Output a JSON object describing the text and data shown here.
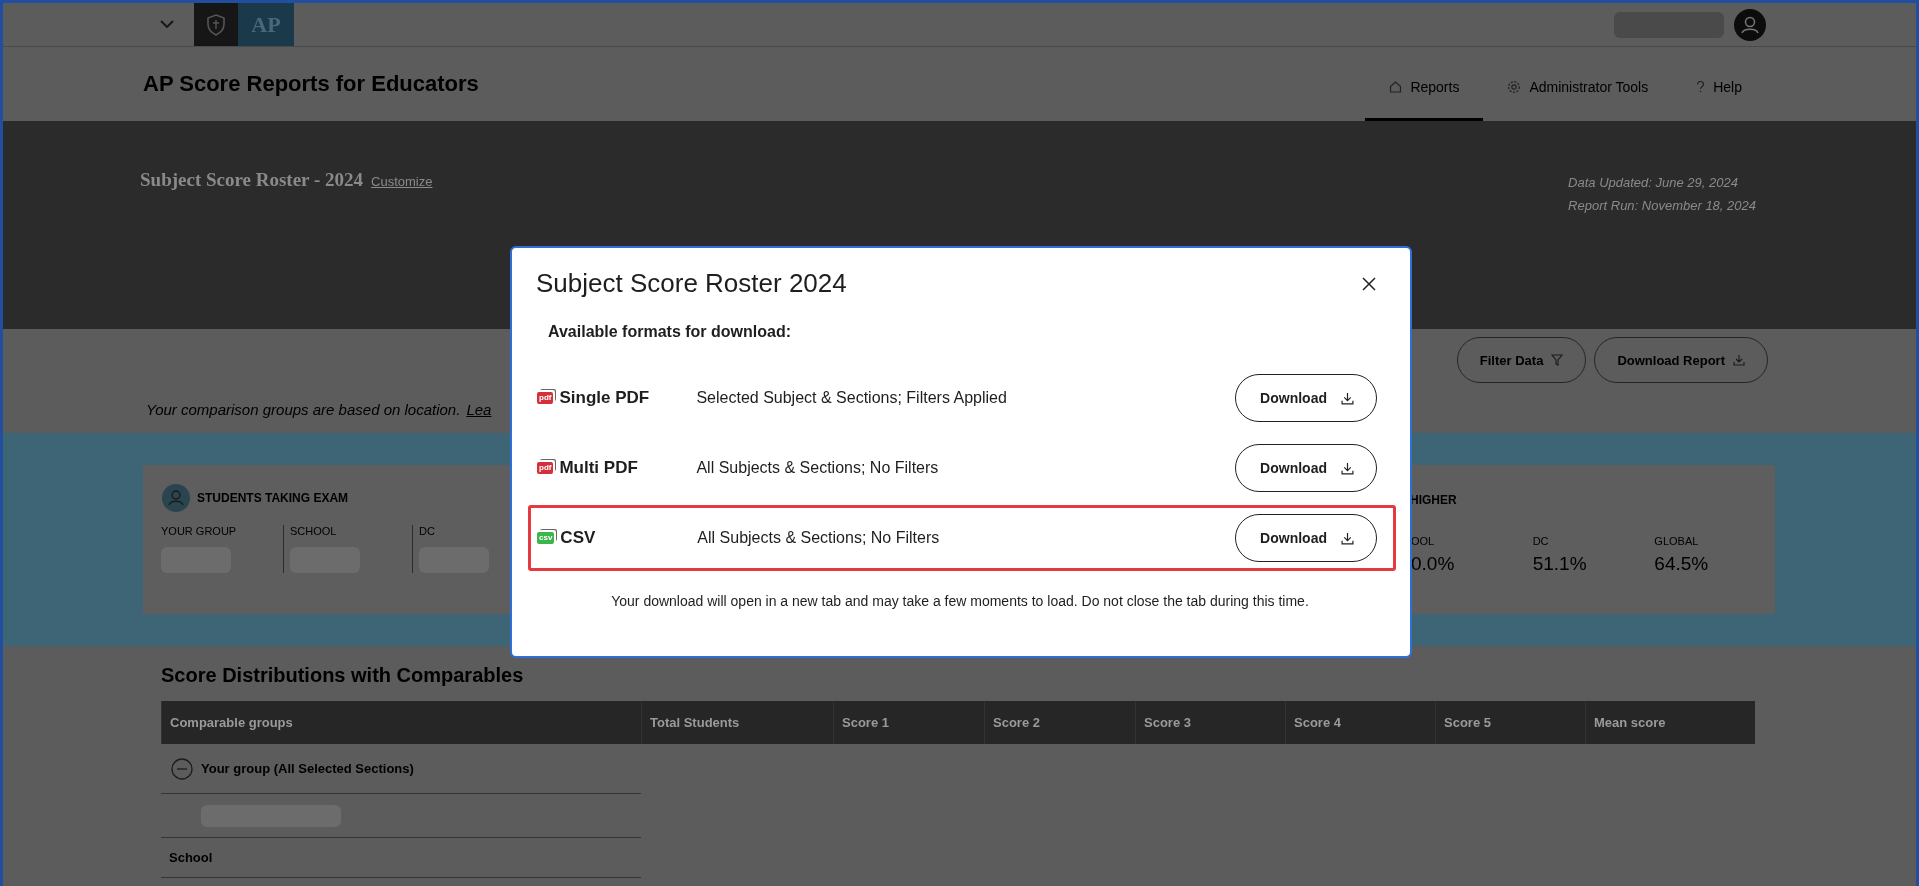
{
  "logo": {
    "text": "AP"
  },
  "page_title": "AP Score Reports for Educators",
  "nav": [
    {
      "label": "Reports",
      "kind": "home",
      "selected": true
    },
    {
      "label": "Administrator Tools",
      "kind": "gear",
      "selected": false
    },
    {
      "label": "Help",
      "kind": "help",
      "selected": false
    }
  ],
  "report": {
    "title": "Subject Score Roster - 2024",
    "customize_link": "Customize",
    "data_updated": "Data Updated: June 29, 2024",
    "report_run": "Report Run: November 18, 2024"
  },
  "actions": [
    {
      "label": "Filter Data",
      "kind": "filter"
    },
    {
      "label": "Download Report",
      "kind": "download"
    }
  ],
  "comparison_note": "Your comparison groups are based on location.",
  "comparison_link": "Lea",
  "stats_card": {
    "title": "STUDENTS TAKING EXAM",
    "columns": [
      "YOUR GROUP",
      "SCHOOL",
      "DC"
    ],
    "right_title": "HIGHER",
    "right_columns": [
      {
        "label": "OOL",
        "value": "0.0%"
      },
      {
        "label": "DC",
        "value": "51.1%"
      },
      {
        "label": "GLOBAL",
        "value": "64.5%"
      }
    ]
  },
  "score_table": {
    "title": "Score Distributions with Comparables",
    "columns": [
      "Comparable groups",
      "Total Students",
      "Score 1",
      "Score 2",
      "Score 3",
      "Score 4",
      "Score 5",
      "Mean score"
    ],
    "rows": [
      {
        "label": "Your group (All Selected Sections)",
        "kind": "group",
        "expanded": true
      },
      {
        "label": "School",
        "kind": "plain"
      }
    ]
  },
  "modal": {
    "title": "Subject Score Roster 2024",
    "subtitle": "Available formats for download:",
    "formats": [
      {
        "name": "Single PDF",
        "file_type": "pdf",
        "description": "Selected Subject & Sections; Filters Applied",
        "button": "Download",
        "highlighted": false
      },
      {
        "name": "Multi PDF",
        "file_type": "pdf",
        "description": "All Subjects & Sections; No Filters",
        "button": "Download",
        "highlighted": false
      },
      {
        "name": "CSV",
        "file_type": "csv",
        "description": "All Subjects & Sections; No Filters",
        "button": "Download",
        "highlighted": true
      }
    ],
    "note": "Your download will open in a new tab and may take a few moments to load. Do not close the tab during this time."
  }
}
